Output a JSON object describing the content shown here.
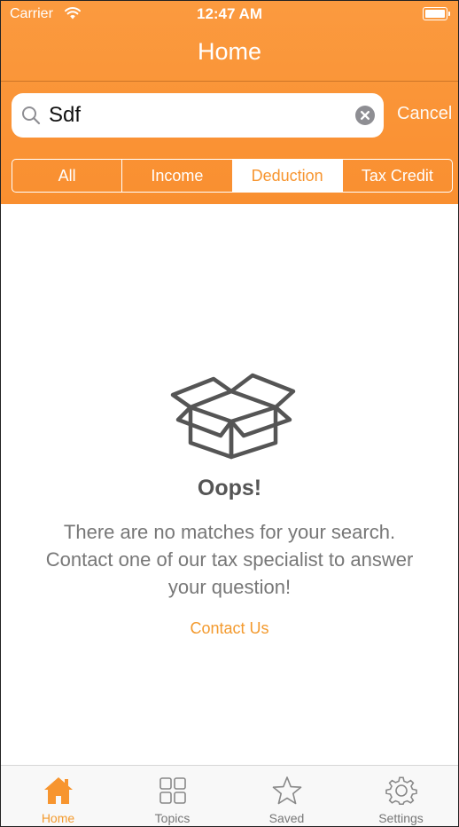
{
  "status_bar": {
    "carrier": "Carrier",
    "time": "12:47 AM"
  },
  "nav": {
    "title": "Home"
  },
  "search": {
    "value": "Sdf",
    "cancel_label": "Cancel"
  },
  "segments": [
    {
      "label": "All",
      "selected": false
    },
    {
      "label": "Income",
      "selected": false
    },
    {
      "label": "Deduction",
      "selected": true
    },
    {
      "label": "Tax Credit",
      "selected": false
    }
  ],
  "empty_state": {
    "icon": "open-box-icon",
    "title": "Oops!",
    "message": "There are no matches for your search. Contact one of our tax specialist to answer your question!",
    "link_label": "Contact Us"
  },
  "tabbar": [
    {
      "label": "Home",
      "icon": "home-icon",
      "active": true
    },
    {
      "label": "Topics",
      "icon": "grid-icon",
      "active": false
    },
    {
      "label": "Saved",
      "icon": "star-icon",
      "active": false
    },
    {
      "label": "Settings",
      "icon": "gear-icon",
      "active": false
    }
  ],
  "colors": {
    "accent": "#f98f30",
    "link": "#f39a2e",
    "tab_inactive": "#777777"
  }
}
